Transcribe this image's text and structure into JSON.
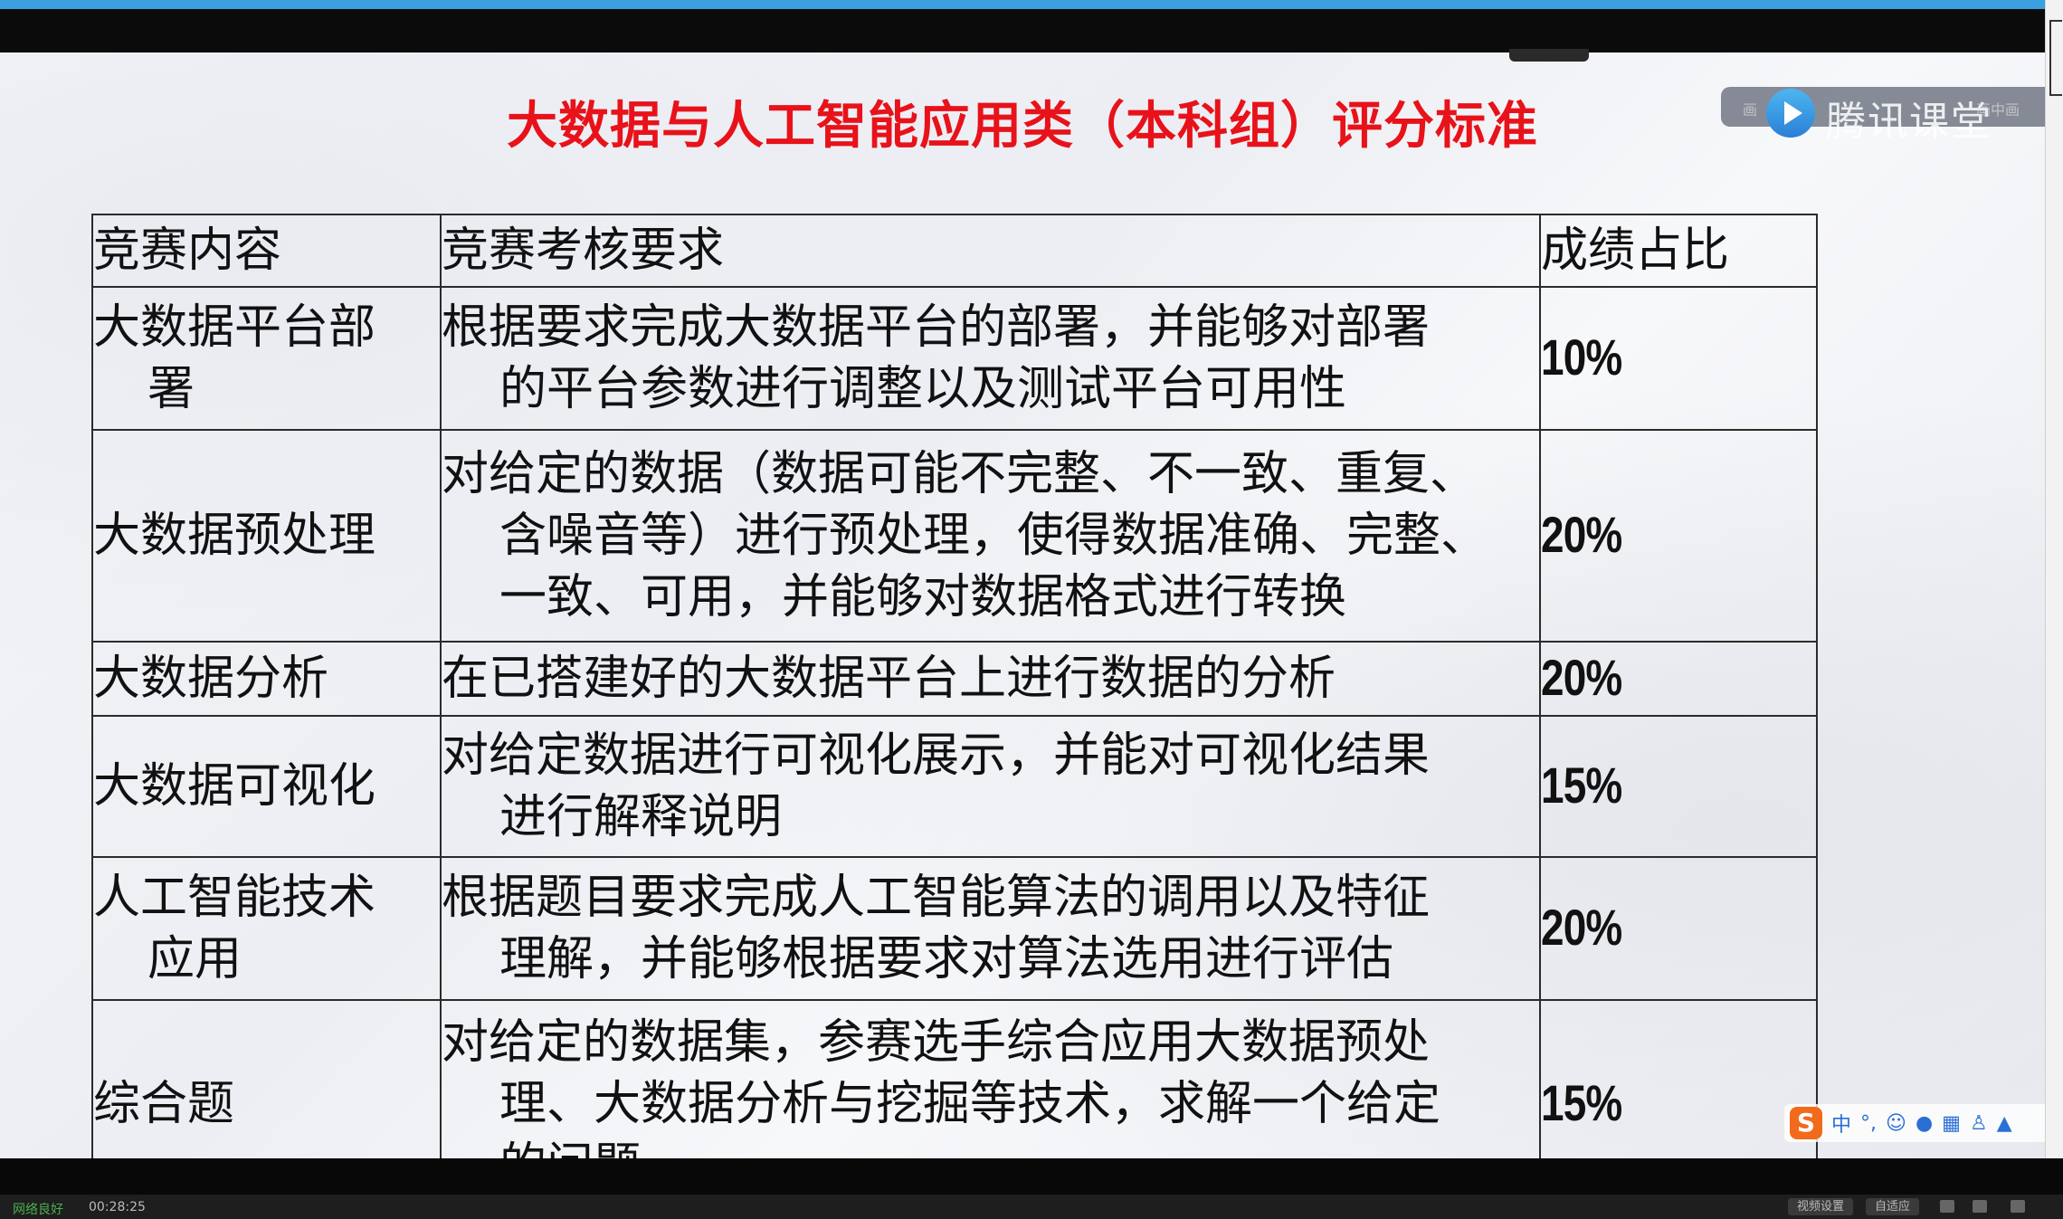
{
  "slide": {
    "title": "大数据与人工智能应用类（本科组）评分标准"
  },
  "watermark": {
    "brand": "腾讯课堂",
    "small_left": "画",
    "small_right": "画中画"
  },
  "table": {
    "headers": [
      "竞赛内容",
      "竞赛考核要求",
      "成绩占比"
    ],
    "rows": [
      {
        "category": [
          "大数据平台部",
          "署"
        ],
        "requirement": [
          "根据要求完成大数据平台的部署，并能够对部署",
          "的平台参数进行调整以及测试平台可用性"
        ],
        "ratio": "10%"
      },
      {
        "category": [
          "大数据预处理"
        ],
        "requirement": [
          "对给定的数据（数据可能不完整、不一致、重复、",
          "含噪音等）进行预处理，使得数据准确、完整、",
          "一致、可用，并能够对数据格式进行转换"
        ],
        "ratio": "20%"
      },
      {
        "category": [
          "大数据分析"
        ],
        "requirement": [
          "在已搭建好的大数据平台上进行数据的分析"
        ],
        "ratio": "20%"
      },
      {
        "category": [
          "大数据可视化"
        ],
        "requirement": [
          "对给定数据进行可视化展示，并能对可视化结果",
          "进行解释说明"
        ],
        "ratio": "15%"
      },
      {
        "category": [
          "人工智能技术",
          "应用"
        ],
        "requirement": [
          "根据题目要求完成人工智能算法的调用以及特征",
          "理解，并能够根据要求对算法选用进行评估"
        ],
        "ratio": "20%"
      },
      {
        "category": [
          "综合题"
        ],
        "requirement": [
          "对给定的数据集，参赛选手综合应用大数据预处",
          "理、大数据分析与挖掘等技术，求解一个给定",
          "的问题"
        ],
        "ratio": "15%"
      }
    ]
  },
  "ime": {
    "logo": "S",
    "mode": "中"
  },
  "status": {
    "network": "网络良好",
    "elapsed": "00:28:25",
    "video_settings": "视频设置",
    "adaptive": "自适应"
  },
  "colors": {
    "title": "#e8121a",
    "top_accent": "#3aa0e0"
  }
}
